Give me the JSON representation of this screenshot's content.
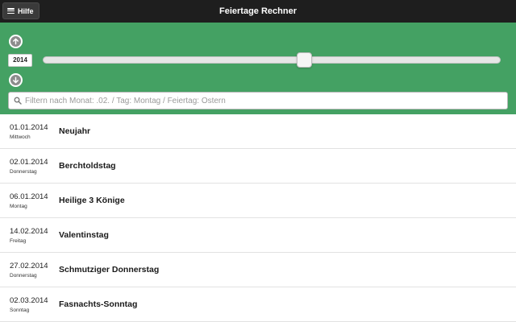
{
  "header": {
    "help_label": "Hilfe",
    "title": "Feiertage Rechner"
  },
  "year_selector": {
    "year": "2014",
    "slider_position_fraction": 0.54
  },
  "filter": {
    "placeholder": "Filtern nach Monat: .02. / Tag: Montag / Feiertag: Ostern",
    "value": ""
  },
  "holidays": [
    {
      "date": "01.01.2014",
      "weekday": "Mittwoch",
      "name": "Neujahr"
    },
    {
      "date": "02.01.2014",
      "weekday": "Donnerstag",
      "name": "Berchtoldstag"
    },
    {
      "date": "06.01.2014",
      "weekday": "Montag",
      "name": "Heilige 3 Könige"
    },
    {
      "date": "14.02.2014",
      "weekday": "Freitag",
      "name": "Valentinstag"
    },
    {
      "date": "27.02.2014",
      "weekday": "Donnerstag",
      "name": "Schmutziger Donnerstag"
    },
    {
      "date": "02.03.2014",
      "weekday": "Sonntag",
      "name": "Fasnachts-Sonntag"
    }
  ],
  "colors": {
    "topbar": "#1e1e1e",
    "green_panel": "#44a163"
  },
  "icons": {
    "menu": "menu-icon",
    "year_up": "arrow-up-circle-icon",
    "year_down": "arrow-down-circle-icon",
    "search": "search-icon"
  }
}
